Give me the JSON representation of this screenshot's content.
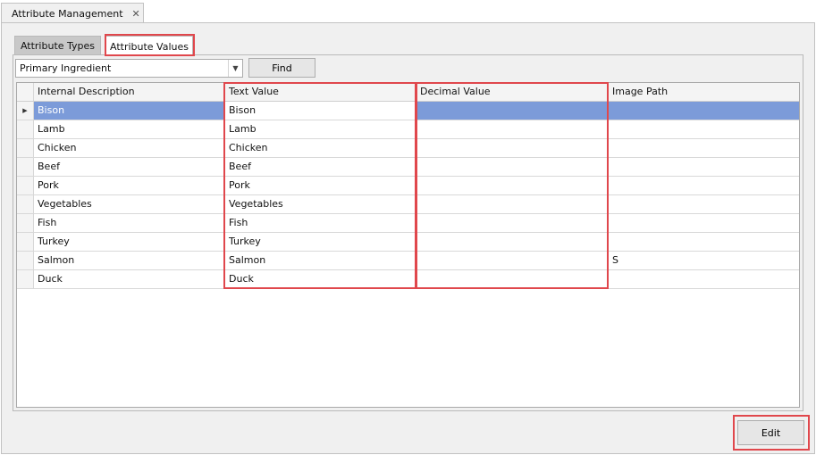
{
  "document_tab": {
    "title": "Attribute Management",
    "close_glyph": "✕"
  },
  "tabs": [
    {
      "label": "Attribute Types",
      "active": false
    },
    {
      "label": "Attribute Values",
      "active": true
    }
  ],
  "filter": {
    "selected_value": "Primary Ingredient",
    "find_label": "Find"
  },
  "grid": {
    "columns": [
      "Internal Description",
      "Text Value",
      "Decimal Value",
      "Image Path"
    ],
    "row_indicator_glyph": "▶",
    "rows": [
      {
        "internal": "Bison",
        "text": "Bison",
        "decimal": "",
        "image": ""
      },
      {
        "internal": "Lamb",
        "text": "Lamb",
        "decimal": "",
        "image": ""
      },
      {
        "internal": "Chicken",
        "text": "Chicken",
        "decimal": "",
        "image": ""
      },
      {
        "internal": "Beef",
        "text": "Beef",
        "decimal": "",
        "image": ""
      },
      {
        "internal": "Pork",
        "text": "Pork",
        "decimal": "",
        "image": ""
      },
      {
        "internal": "Vegetables",
        "text": "Vegetables",
        "decimal": "",
        "image": ""
      },
      {
        "internal": "Fish",
        "text": "Fish",
        "decimal": "",
        "image": ""
      },
      {
        "internal": "Turkey",
        "text": "Turkey",
        "decimal": "",
        "image": ""
      },
      {
        "internal": "Salmon",
        "text": "Salmon",
        "decimal": "",
        "image": "S"
      },
      {
        "internal": "Duck",
        "text": "Duck",
        "decimal": "",
        "image": ""
      }
    ]
  },
  "actions": {
    "edit_label": "Edit"
  },
  "colors": {
    "highlight": "#e0474c",
    "selection": "#7c9bd9"
  }
}
